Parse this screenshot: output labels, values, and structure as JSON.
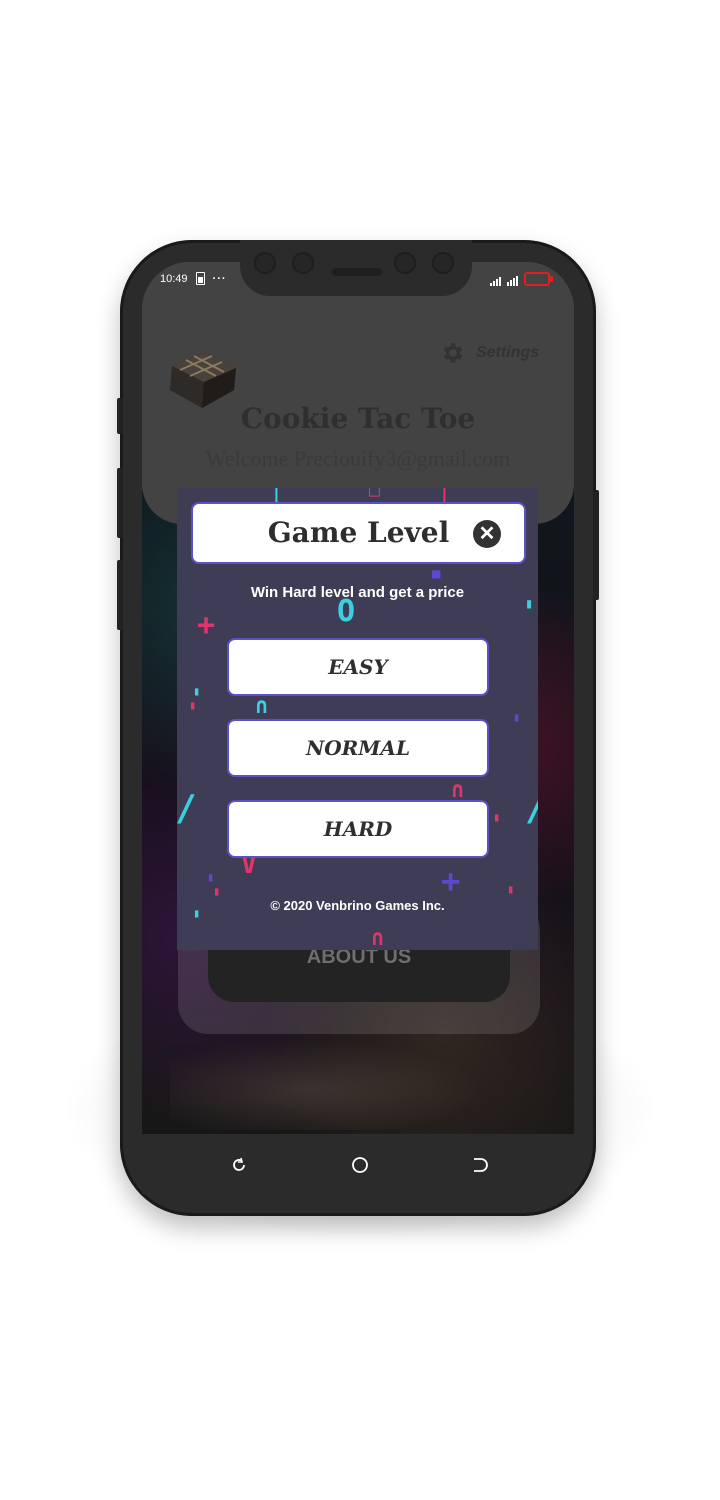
{
  "status_bar": {
    "time": "10:49",
    "more_icon": "more-dots-icon",
    "signal_icon": "cell-signal-icon",
    "battery_icon": "battery-low-icon",
    "battery_color": "#e02020"
  },
  "header": {
    "logo_icon": "cookie-tic-tac-toe-logo-icon",
    "settings_icon": "gear-icon",
    "settings_label": "Settings",
    "app_title": "Cookie Tac Toe",
    "welcome_text": "Welcome Preciouify3@gmail.com"
  },
  "dialog": {
    "title": "Game Level",
    "close_icon": "close-icon",
    "subtitle": "Win Hard level and get a price",
    "levels": [
      "EASY",
      "NORMAL",
      "HARD"
    ],
    "copyright": "© 2020 Venbrino Games Inc.",
    "background_color": "#3f3d55",
    "accent_color": "#5b52c8"
  },
  "background_menu": {
    "about_label": "ABOUT US"
  },
  "nav_bar": {
    "back_icon": "back-icon",
    "home_icon": "home-icon",
    "recents_icon": "recents-icon"
  }
}
